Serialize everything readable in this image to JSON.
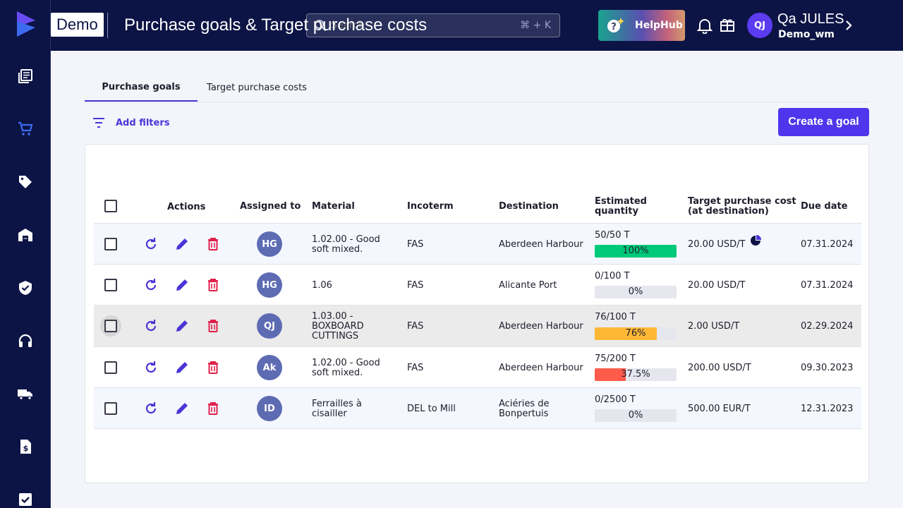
{
  "app": {
    "badge": "Demo",
    "title": "Purchase goals & Target purchase costs"
  },
  "search": {
    "placeholder": "Search",
    "shortcut": "⌘ + K"
  },
  "helphub": {
    "label": "HelpHub"
  },
  "user": {
    "initials": "QJ",
    "name": "Qa JULES",
    "org": "Demo_wm"
  },
  "tabs": [
    {
      "label": "Purchase goals",
      "active": true
    },
    {
      "label": "Target purchase costs",
      "active": false
    }
  ],
  "toolbar": {
    "filters_label": "Add filters",
    "create_label": "Create a goal"
  },
  "table": {
    "headers": {
      "actions": "Actions",
      "assigned": "Assigned to",
      "material": "Material",
      "incoterm": "Incoterm",
      "destination": "Destination",
      "quantity_1": "Estimated",
      "quantity_2": "quantity",
      "cost_1": "Target purchase cost",
      "cost_2": "(at destination)",
      "due": "Due date"
    },
    "rows": [
      {
        "assignee": "HG",
        "material": "1.02.00 - Good soft mixed.",
        "incoterm": "FAS",
        "destination": "Aberdeen Harbour",
        "qty": "50/50 T",
        "progress": 100,
        "progress_label": "100%",
        "progress_color": "#00c97a",
        "cost": "20.00 USD/T",
        "due": "07.31.2024"
      },
      {
        "assignee": "HG",
        "material": "1.06",
        "incoterm": "FAS",
        "destination": "Alicante Port",
        "qty": "0/100 T",
        "progress": 0,
        "progress_label": "0%",
        "progress_color": "#e6e6ee",
        "cost": "20.00 USD/T",
        "due": "07.31.2024"
      },
      {
        "assignee": "QJ",
        "material": "1.03.00 - BOXBOARD CUTTINGS",
        "incoterm": "FAS",
        "destination": "Aberdeen Harbour",
        "qty": "76/100 T",
        "progress": 76,
        "progress_label": "76%",
        "progress_color": "#ffb836",
        "cost": "2.00 USD/T",
        "due": "02.29.2024"
      },
      {
        "assignee": "Ak",
        "material": "1.02.00 - Good soft mixed.",
        "incoterm": "FAS",
        "destination": "Aberdeen Harbour",
        "qty": "75/200 T",
        "progress": 37.5,
        "progress_label": "37.5%",
        "progress_color": "#ff5b4a",
        "cost": "200.00 USD/T",
        "due": "09.30.2023"
      },
      {
        "assignee": "ID",
        "material": "Ferrailles à cisailler",
        "incoterm": "DEL to Mill",
        "destination": "Aciéries de Bonpertuis",
        "qty": "0/2500 T",
        "progress": 0,
        "progress_label": "0%",
        "progress_color": "#e6e6ee",
        "cost": "500.00 EUR/T",
        "due": "12.31.2023"
      }
    ]
  },
  "colors": {
    "nav": "#0c1445",
    "accent": "#4f36ec",
    "action_icon": "#4a35d8",
    "delete_icon": "#e0204a"
  }
}
